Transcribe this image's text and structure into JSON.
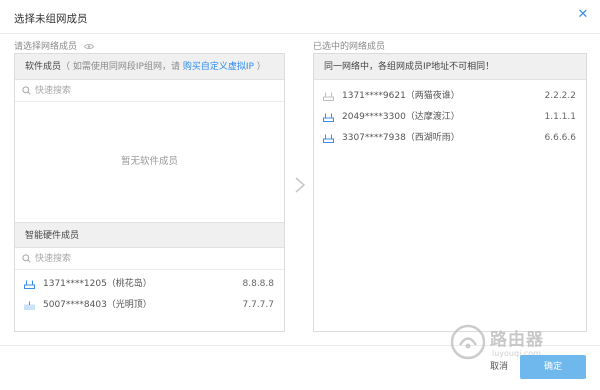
{
  "dialog": {
    "title": "选择未组网成员",
    "close_icon": "close-icon"
  },
  "left": {
    "label": "请选择网络成员",
    "software": {
      "header": "软件成员",
      "hint_before": "（ 如需使用同网段IP组网，请 ",
      "link": "购买自定义虚拟IP",
      "hint_after": " ）",
      "search_placeholder": "快速搜索",
      "empty": "暂无软件成员"
    },
    "hardware": {
      "header": "智能硬件成员",
      "search_placeholder": "快速搜索",
      "items": [
        {
          "name": "1371****1205（桃花岛）",
          "ip": "8.8.8.8"
        },
        {
          "name": "5007****8403（光明顶）",
          "ip": "7.7.7.7"
        }
      ]
    }
  },
  "right": {
    "label": "已选中的网络成员",
    "header": "同一网络中，各组网成员IP地址不可相同！",
    "items": [
      {
        "name": "1371****9621（两猫夜谁）",
        "ip": "2.2.2.2"
      },
      {
        "name": "2049****3300（达摩渡江）",
        "ip": "1.1.1.1"
      },
      {
        "name": "3307****7938（西湖听雨）",
        "ip": "6.6.6.6"
      }
    ]
  },
  "footer": {
    "cancel": "取消",
    "confirm": "确定"
  },
  "watermark": {
    "text": "路由器",
    "sub": "luyouqi.com"
  },
  "colors": {
    "accent": "#3a8ee6",
    "link": "#2d8cf0",
    "confirm_bg": "#6fb8ee",
    "router_icon": "#3a8ee6"
  }
}
